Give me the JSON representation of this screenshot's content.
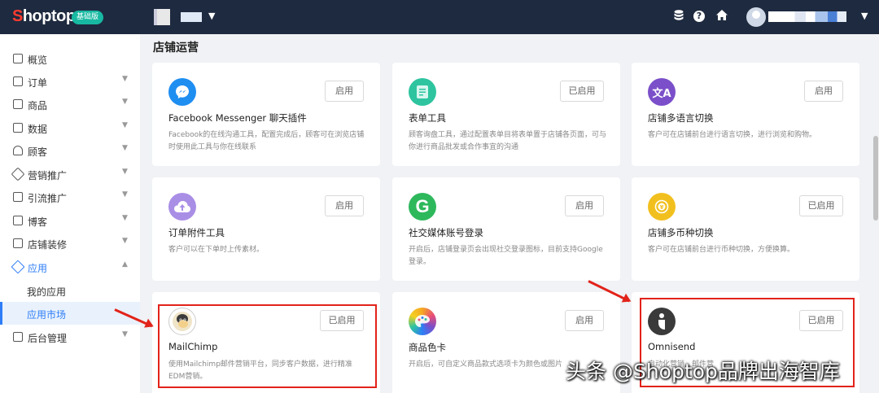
{
  "header": {
    "logo_first": "S",
    "logo_rest": "hoptop",
    "edition": "基础版",
    "store_caret": "▼",
    "user_caret": "▼"
  },
  "sidebar": {
    "items": [
      {
        "label": "概览"
      },
      {
        "label": "订单"
      },
      {
        "label": "商品"
      },
      {
        "label": "数据"
      },
      {
        "label": "顾客"
      },
      {
        "label": "营销推广"
      },
      {
        "label": "引流推广"
      },
      {
        "label": "博客"
      },
      {
        "label": "店铺装修"
      },
      {
        "label": "应用"
      },
      {
        "label": "我的应用"
      },
      {
        "label": "应用市场"
      },
      {
        "label": "后台管理"
      }
    ]
  },
  "main": {
    "section_title": "店铺运营",
    "cards": [
      {
        "name": "Facebook Messenger 聊天插件",
        "button": "启用",
        "desc": "Facebook的在线沟通工具，配置完成后，顾客可在浏览店铺时使用此工具与你在线联系",
        "icon": "messenger-icon",
        "icon_color": "#1f8ef1"
      },
      {
        "name": "表单工具",
        "button": "已启用",
        "desc": "顾客询盘工具，通过配置表单目将表单置于店铺各页面，可与你进行商品批发或合作事宜的沟通",
        "icon": "form-icon",
        "icon_color": "#2ec4a0"
      },
      {
        "name": "店铺多语言切换",
        "button": "启用",
        "desc": "客户可在店铺前台进行语言切换，进行浏览和购物。",
        "icon": "translate-icon",
        "icon_color": "#7b4fc9"
      },
      {
        "name": "订单附件工具",
        "button": "启用",
        "desc": "客户可以在下单时上传素材。",
        "icon": "upload-cloud-icon",
        "icon_color": "#a98ee6"
      },
      {
        "name": "社交媒体账号登录",
        "button": "启用",
        "desc": "开启后，店铺登录页会出现社交登录图标，目前支持Google登录。",
        "icon": "google-icon",
        "icon_color": "#2eb85c"
      },
      {
        "name": "店铺多币种切换",
        "button": "已启用",
        "desc": "客户可在店铺前台进行币种切换，方便换算。",
        "icon": "currency-icon",
        "icon_color": "#f2c01e"
      },
      {
        "name": "MailChimp",
        "button": "已启用",
        "desc": "使用Mailchimp邮件营销平台，同步客户数据，进行精准EDM营销。",
        "icon": "mailchimp-icon",
        "icon_color": "#ffffff"
      },
      {
        "name": "商品色卡",
        "button": "启用",
        "desc": "开启后，可自定义商品款式选项卡为颜色或图片",
        "icon": "palette-icon",
        "icon_color": "#f5a623"
      },
      {
        "name": "Omnisend",
        "button": "已启用",
        "desc": "自动化营销，邮件营",
        "icon": "omnisend-icon",
        "icon_color": "#3a3a3a"
      }
    ]
  },
  "watermark": "头条 @Shoptop品牌出海智库"
}
